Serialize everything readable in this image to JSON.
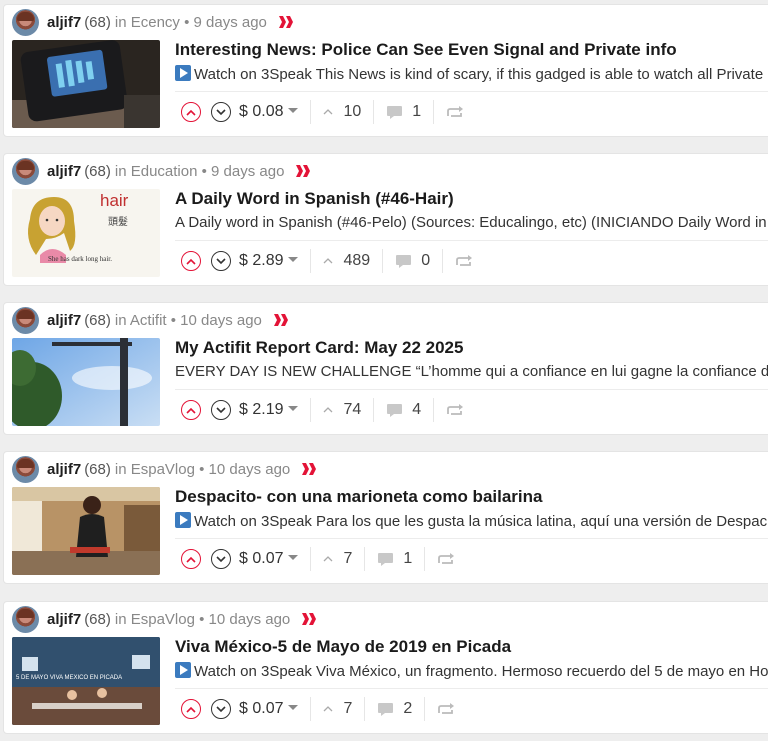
{
  "posts": [
    {
      "author": "aljif7",
      "reputation": "(68)",
      "community": "Ecency",
      "age": "9 days ago",
      "title": "Interesting News: Police Can See Even Signal and Private info",
      "summary": "Watch on 3Speak This News is kind of scary, if this gadged is able to watch all Private",
      "has_play_icon": true,
      "payout": "$ 0.08",
      "votes": "10",
      "comments": "1",
      "thumb": "device"
    },
    {
      "author": "aljif7",
      "reputation": "(68)",
      "community": "Education",
      "age": "9 days ago",
      "title": "A Daily Word in Spanish (#46-Hair)",
      "summary": "A Daily word in Spanish (#46-Pelo) (Sources: Educalingo, etc) (INICIANDO Daily Word in S",
      "has_play_icon": false,
      "payout": "$ 2.89",
      "votes": "489",
      "comments": "0",
      "thumb": "hair",
      "thumb_text": {
        "word": "hair",
        "chinese": "頭髮",
        "caption": "She has  dark long hair."
      }
    },
    {
      "author": "aljif7",
      "reputation": "(68)",
      "community": "Actifit",
      "age": "10 days ago",
      "title": "My Actifit Report Card: May 22 2025",
      "summary": "EVERY DAY IS NEW CHALLENGE “L’homme qui a confiance en lui gagne la confiance des a",
      "has_play_icon": false,
      "payout": "$ 2.19",
      "votes": "74",
      "comments": "4",
      "thumb": "sky"
    },
    {
      "author": "aljif7",
      "reputation": "(68)",
      "community": "EspaVlog",
      "age": "10 days ago",
      "title": "Despacito- con una marioneta como bailarina",
      "summary": "Watch on 3Speak Para los que les gusta la música latina, aquí una versión de Despaci",
      "has_play_icon": true,
      "payout": "$ 0.07",
      "votes": "7",
      "comments": "1",
      "thumb": "street"
    },
    {
      "author": "aljif7",
      "reputation": "(68)",
      "community": "EspaVlog",
      "age": "10 days ago",
      "title": "Viva México-5 de Mayo de 2019 en Picada",
      "summary": "Watch on 3Speak Viva México, un fragmento. Hermoso recuerdo del 5 de mayo en Ho",
      "has_play_icon": true,
      "payout": "$ 0.07",
      "votes": "7",
      "comments": "2",
      "thumb": "restaurant",
      "thumb_text": {
        "banner": "5 DE MAYO VIVA MEXICO EN PICADA"
      }
    }
  ],
  "colors": {
    "upvote": "#e31337",
    "hive": "#e31337"
  }
}
